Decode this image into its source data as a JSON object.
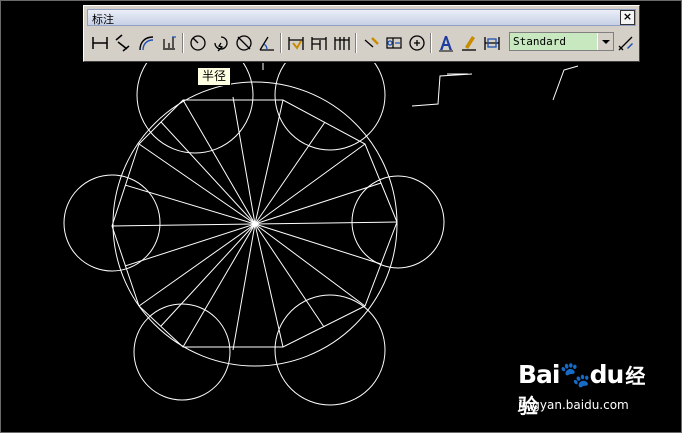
{
  "toolbar": {
    "title": "标注",
    "close_label": "×",
    "buttons": [
      {
        "name": "linear-dimension",
        "icon": "linear-dim-icon"
      },
      {
        "name": "aligned-dimension",
        "icon": "aligned-dim-icon"
      },
      {
        "name": "arc-length-dimension",
        "icon": "arc-length-icon"
      },
      {
        "name": "ordinate-dimension",
        "icon": "ordinate-icon"
      },
      {
        "name": "radius-dimension",
        "icon": "radius-icon"
      },
      {
        "name": "jogged-dimension",
        "icon": "jogged-icon"
      },
      {
        "name": "diameter-dimension",
        "icon": "diameter-icon"
      },
      {
        "name": "angular-dimension",
        "icon": "angular-icon"
      },
      {
        "name": "quick-dimension",
        "icon": "quick-dim-icon"
      },
      {
        "name": "baseline-dimension",
        "icon": "baseline-icon"
      },
      {
        "name": "continue-dimension",
        "icon": "continue-icon"
      },
      {
        "name": "quick-leader",
        "icon": "leader-icon"
      },
      {
        "name": "tolerance",
        "icon": "tolerance-icon"
      },
      {
        "name": "center-mark",
        "icon": "center-mark-icon"
      },
      {
        "name": "dimension-edit",
        "icon": "dim-edit-icon"
      },
      {
        "name": "dimension-text-edit",
        "icon": "dim-text-edit-icon"
      },
      {
        "name": "dimension-update",
        "icon": "dim-update-icon"
      },
      {
        "name": "dimension-style",
        "icon": "dim-style-icon"
      }
    ],
    "style_combo": {
      "value": "Standard"
    }
  },
  "tooltip": {
    "text": "半径"
  },
  "drawing": {
    "stroke_color": "#ffffff",
    "background": "#000000"
  },
  "watermark": {
    "logo": "Bai du 经验",
    "logo_bai": "Bai",
    "logo_du": "du",
    "logo_jy": "经验",
    "url": "jingyan.baidu.com"
  }
}
